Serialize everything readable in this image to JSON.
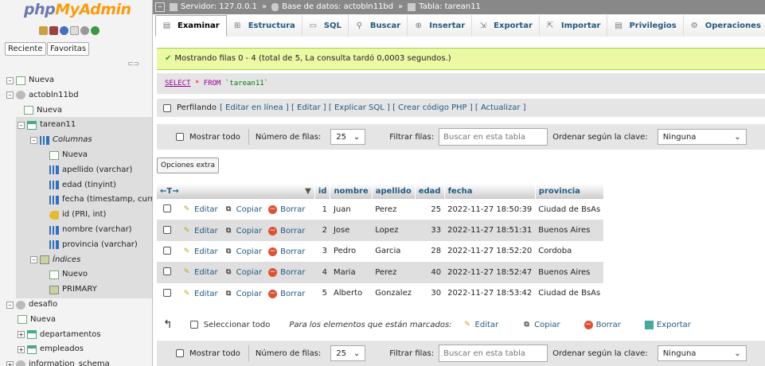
{
  "logo": {
    "php": "php",
    "my": "MyAdmin"
  },
  "nav_tabs": {
    "recent": "Reciente",
    "favorites": "Favoritas"
  },
  "link_icon": "⊂⊃",
  "tree": [
    {
      "label": "Nueva",
      "icon": "new-icon",
      "italic": false
    },
    {
      "label": "actobln11bd",
      "icon": "database-icon",
      "italic": false
    },
    {
      "label": "Nueva",
      "icon": "new-icon",
      "italic": false
    },
    {
      "label": "tarean11",
      "icon": "table-icon",
      "italic": false
    },
    {
      "label": "Columnas",
      "icon": "columns-icon",
      "italic": true
    },
    {
      "label": "Nueva",
      "icon": "new-icon",
      "italic": false
    },
    {
      "label": "apellido (varchar)",
      "icon": "column-icon",
      "italic": false
    },
    {
      "label": "edad (tinyint)",
      "icon": "column-icon",
      "italic": false
    },
    {
      "label": "fecha (timestamp, curr",
      "icon": "column-icon",
      "italic": false
    },
    {
      "label": "id (PRI, int)",
      "icon": "key-icon",
      "italic": false
    },
    {
      "label": "nombre (varchar)",
      "icon": "column-icon",
      "italic": false
    },
    {
      "label": "provincia (varchar)",
      "icon": "column-icon",
      "italic": false
    },
    {
      "label": "Índices",
      "icon": "index-icon",
      "italic": true
    },
    {
      "label": "Nuevo",
      "icon": "new-icon",
      "italic": false
    },
    {
      "label": "PRIMARY",
      "icon": "index-icon",
      "italic": false
    },
    {
      "label": "desafio",
      "icon": "database-icon",
      "italic": false
    },
    {
      "label": "Nueva",
      "icon": "new-icon",
      "italic": false
    },
    {
      "label": "departamentos",
      "icon": "table-icon",
      "italic": false
    },
    {
      "label": "empleados",
      "icon": "table-icon",
      "italic": false
    },
    {
      "label": "information_schema",
      "icon": "database-icon",
      "italic": false
    }
  ],
  "breadcrumb": {
    "server": "Servidor: 127.0.0.1",
    "database": "Base de datos: actobln11bd",
    "table": "Tabla: tarean11",
    "sep": "»"
  },
  "tabs": [
    "Examinar",
    "Estructura",
    "SQL",
    "Buscar",
    "Insertar",
    "Exportar",
    "Importar",
    "Privilegios",
    "Operaciones"
  ],
  "success_message": "Mostrando filas 0 - 4 (total de 5, La consulta tardó 0,0003 segundos.)",
  "sql": {
    "select": "SELECT",
    "star": "*",
    "from": "FROM",
    "table": "`tarean11`"
  },
  "profiling": {
    "label": "Perfilando",
    "links": [
      "[ Editar en línea ]",
      "[ Editar ]",
      "[ Explicar SQL ]",
      "[ Crear código PHP ]",
      "[ Actualizar ]"
    ]
  },
  "navbar": {
    "show_all": "Mostrar todo",
    "rows_label": "Número de filas:",
    "rows_value": "25",
    "filter_label": "Filtrar filas:",
    "filter_placeholder": "Buscar en esta tabla",
    "sort_label": "Ordenar según la clave:",
    "sort_value": "Ninguna"
  },
  "extra_options": "Opciones extra",
  "table": {
    "nav_arrows": "←T→",
    "columns": [
      "id",
      "nombre",
      "apellido",
      "edad",
      "fecha",
      "provincia"
    ],
    "actions": {
      "edit": "Editar",
      "copy": "Copiar",
      "delete": "Borrar"
    },
    "rows": [
      [
        "1",
        "Juan",
        "Perez",
        "25",
        "2022-11-27 18:50:39",
        "Ciudad de BsAs"
      ],
      [
        "2",
        "Jose",
        "Lopez",
        "33",
        "2022-11-27 18:51:31",
        "Buenos Aires"
      ],
      [
        "3",
        "Pedro",
        "Garcia",
        "28",
        "2022-11-27 18:52:20",
        "Cordoba"
      ],
      [
        "4",
        "Maria",
        "Perez",
        "40",
        "2022-11-27 18:52:47",
        "Buenos Aires"
      ],
      [
        "5",
        "Alberto",
        "Gonzalez",
        "30",
        "2022-11-27 18:53:42",
        "Ciudad de BsAs"
      ]
    ]
  },
  "bulk": {
    "select_all": "Seleccionar todo",
    "with_selected": "Para los elementos que están marcados:",
    "edit": "Editar",
    "copy": "Copiar",
    "delete": "Borrar",
    "export": "Exportar"
  },
  "colors": {
    "accent": "#235a81",
    "success_bg": "#ebf8a4",
    "topbar": "#888888"
  }
}
